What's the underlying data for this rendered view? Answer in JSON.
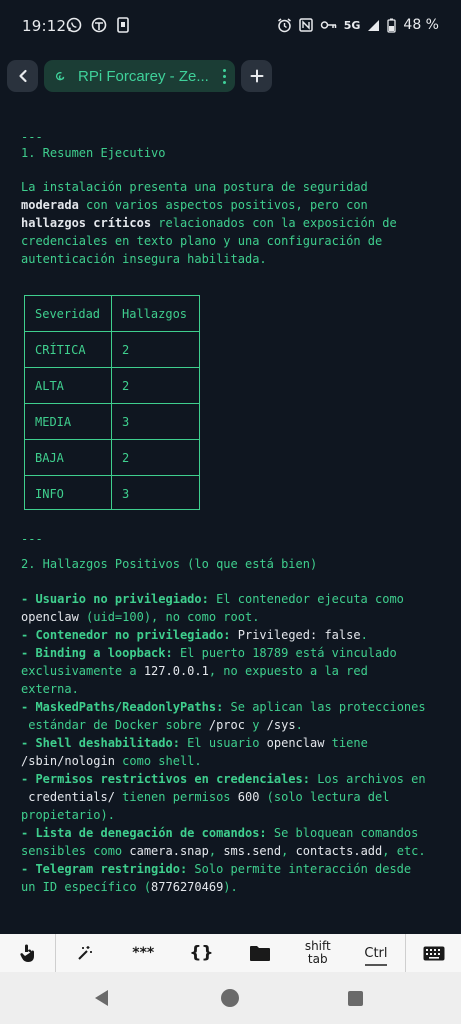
{
  "status": {
    "time": "19:12",
    "signal": "5G",
    "battery": "48 %"
  },
  "header": {
    "tab_title": "RPi Forcarey - Ze..."
  },
  "doc": {
    "sep1": "---",
    "h1": "1. Resumen Ejecutivo",
    "p1": {
      "l1": "La instalación presenta una postura de seguridad",
      "l2a": "moderada",
      "l2b": " con varios aspectos positivos, pero con",
      "l3a": "hallazgos críticos",
      "l3b": " relacionados con la exposición de",
      "l4": "credenciales en texto plano y una configuración de",
      "l5": "autenticación insegura habilitada."
    },
    "table": {
      "headers": [
        "Severidad",
        "Hallazgos"
      ],
      "rows": [
        [
          "CRÍTICA",
          "2"
        ],
        [
          "ALTA",
          "2"
        ],
        [
          "MEDIA",
          "3"
        ],
        [
          "BAJA",
          "2"
        ],
        [
          "INFO",
          "3"
        ]
      ]
    },
    "sep2": "---",
    "h2": "2. Hallazgos Positivos (lo que está bien)",
    "items": {
      "i1a": "- Usuario no privilegiado:",
      "i1b": " El contenedor ejecuta como",
      "i1c": "openclaw",
      "i1d": " (uid=100), no como root.",
      "i2a": "- Contenedor no privilegiado:",
      "i2b": " ",
      "i2c": "Privileged: false",
      "i2d": ".",
      "i3a": "- Binding a loopback:",
      "i3b": " El puerto 18789 está vinculado",
      "i3c": "exclusivamente a ",
      "i3d": "127.0.0.1",
      "i3e": ", no expuesto a la red",
      "i3f": "externa.",
      "i4a": "- MaskedPaths/ReadonlyPaths:",
      "i4b": " Se aplican las protecciones",
      "i4c": " estándar de Docker sobre ",
      "i4d": "/proc",
      "i4e": " y ",
      "i4f": "/sys",
      "i4g": ".",
      "i5a": "- Shell deshabilitado:",
      "i5b": " El usuario ",
      "i5c": "openclaw",
      "i5d": " tiene",
      "i5e": "/sbin/nologin",
      "i5f": " como shell.",
      "i6a": "- Permisos restrictivos en credenciales:",
      "i6b": " Los archivos en",
      "i6c": " credentials/",
      "i6d": " tienen permisos ",
      "i6e": "600",
      "i6f": " (solo lectura del",
      "i6g": "propietario).",
      "i7a": "- Lista de denegación de comandos:",
      "i7b": " Se bloquean comandos",
      "i7c": "sensibles como ",
      "i7d": "camera.snap",
      "i7e": ", ",
      "i7f": "sms.send",
      "i7g": ", ",
      "i7h": "contacts.add",
      "i7i": ", etc.",
      "i8a": "- Telegram restringido:",
      "i8b": " Solo permite interacción desde",
      "i8c": "un ID específico (",
      "i8d": "8776270469",
      "i8e": ")."
    }
  },
  "toolbar": {
    "stars": "***",
    "braces": "{}",
    "shift": "shift",
    "tab": "tab",
    "ctrl": "Ctrl"
  },
  "colors": {
    "background": "#0f1620",
    "terminal_green": "#3fcf8e",
    "code_white": "#e4e7ec",
    "tab_bg": "#1b3d35"
  }
}
